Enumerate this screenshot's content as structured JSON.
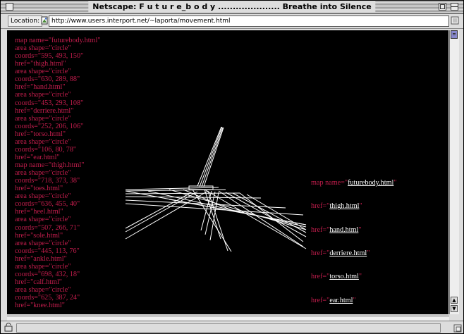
{
  "window": {
    "title": "Netscape: F u t u r e_b o d y ..................... Breathe into Silence"
  },
  "location": {
    "label": "Location:",
    "url": "http://www.users.interport.net/~laporta/movement.html"
  },
  "content": {
    "left_code": [
      "map name=\"futurebody.html\"",
      "area shape=\"circle\"",
      "coords=\"595, 493, 150\"",
      "href=\"thigh.html\"",
      "area shape=\"circle\"",
      "coords=\"630, 289, 88\"",
      "href=\"hand.html\"",
      "area shape=\"circle\"",
      "coords=\"453, 293, 108\"",
      "href=\"derriere.html\"",
      "area shape=\"circle\"",
      "coords=\"252, 206, 106\"",
      "href=\"torso.html\"",
      "area shape=\"circle\"",
      "coords=\"106, 80, 78\"",
      "href=\"ear.html\"",
      "map name=\"thigh.html\"",
      "area shape=\"circle\"",
      "coords=\"718, 373, 38\"",
      "href=\"toes.html\"",
      "area shape=\"circle\"",
      "coords=\"636, 455, 40\"",
      "href=\"heel.html\"",
      "area shape=\"circle\"",
      "coords=\"507, 266, 71\"",
      "href=\"sole.html\"",
      "area shape=\"circle\"",
      "coords=\"445, 113, 76\"",
      "href=\"ankle.html\"",
      "area shape=\"circle\"",
      "coords=\"698, 432, 18\"",
      "href=\"calf.html\"",
      "area shape=\"circle\"",
      "coords=\"625, 387, 24\"",
      "href=\"knee.html\""
    ],
    "right_code": {
      "map_prefix": "map name=\"",
      "map_link": "futurebody.html",
      "map_suffix": "\"",
      "href_prefix": "href=\"",
      "href_suffix": "\"",
      "links": [
        "thigh.html",
        "hand.html",
        "derriere.html",
        "torso.html",
        "ear.html"
      ]
    },
    "colors": {
      "code_text": "#c41d4d",
      "link_text": "#ffffff",
      "background": "#000000"
    }
  },
  "icons": {
    "close": "close-box-icon",
    "zoom": "zoom-box-icon",
    "collapse": "collapse-box-icon",
    "location": "page-proxy-icon",
    "status": "security-lock-icon"
  }
}
